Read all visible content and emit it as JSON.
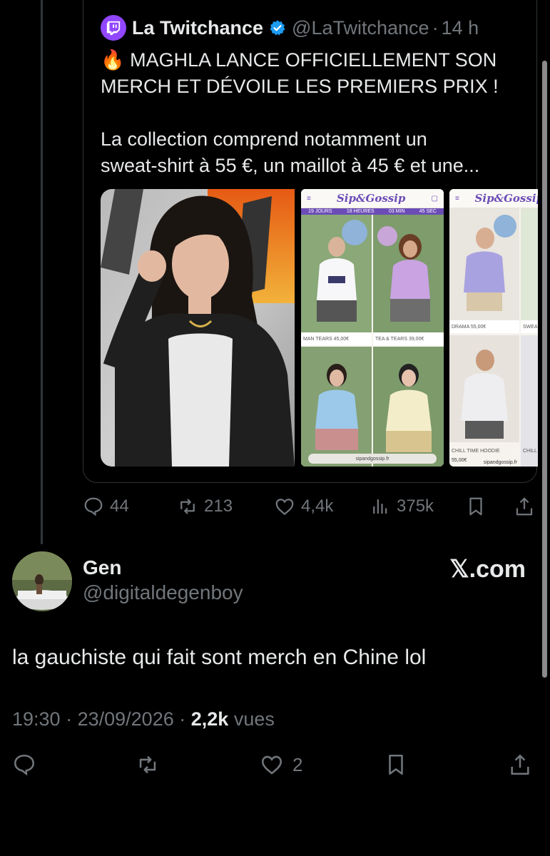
{
  "quoted_tweet": {
    "author_name": "La Twitchance",
    "handle": "@LaTwitchance",
    "separator": "·",
    "time": "14 h",
    "avatar_label": "LA TWITCHANCE",
    "text_line1": "🔥 MAGHLA LANCE OFFICIELLEMENT SON",
    "text_line2": "MERCH ET DÉVOILE LES PREMIERS PRIX !",
    "text_line3": "La collection comprend notamment un",
    "text_line4": "sweat-shirt à 55 €, un maillot à 45 € et une...",
    "shop": {
      "logo": "Sip&Gossip",
      "countdown": [
        "19 JOURS",
        "18 HEURES",
        "03 MIN",
        "45 SEC"
      ],
      "captions": {
        "man_tears": "MAN TEARS  45,00€",
        "tea_tears": "TEA & TEARS  39,00€",
        "drama": "DRAMA  55,00€",
        "sweat": "SWEA",
        "chill_hoodie": "CHILL TIME HOODIE",
        "chill_price": "55,00€",
        "chill2": "CHILL",
        "site": "sipandgossip.fr",
        "site_url": "sipandgossip.fr"
      }
    },
    "stats": {
      "replies": "44",
      "reposts": "213",
      "likes": "4,4k",
      "views": "375k"
    }
  },
  "reply": {
    "author_name": "Gen",
    "handle": "@digitaldegenboy",
    "brand": "𝕏.com",
    "text": "la gauchiste qui fait sont merch en Chine lol",
    "time": "19:30",
    "date": "23/09/2026",
    "views_count": "2,2k",
    "views_label": "vues",
    "likes": "2"
  },
  "colors": {
    "background": "#000000",
    "text": "#e7e9ea",
    "muted": "#71767b",
    "verified": "#1d9bf0",
    "twitch": "#9146ff"
  }
}
